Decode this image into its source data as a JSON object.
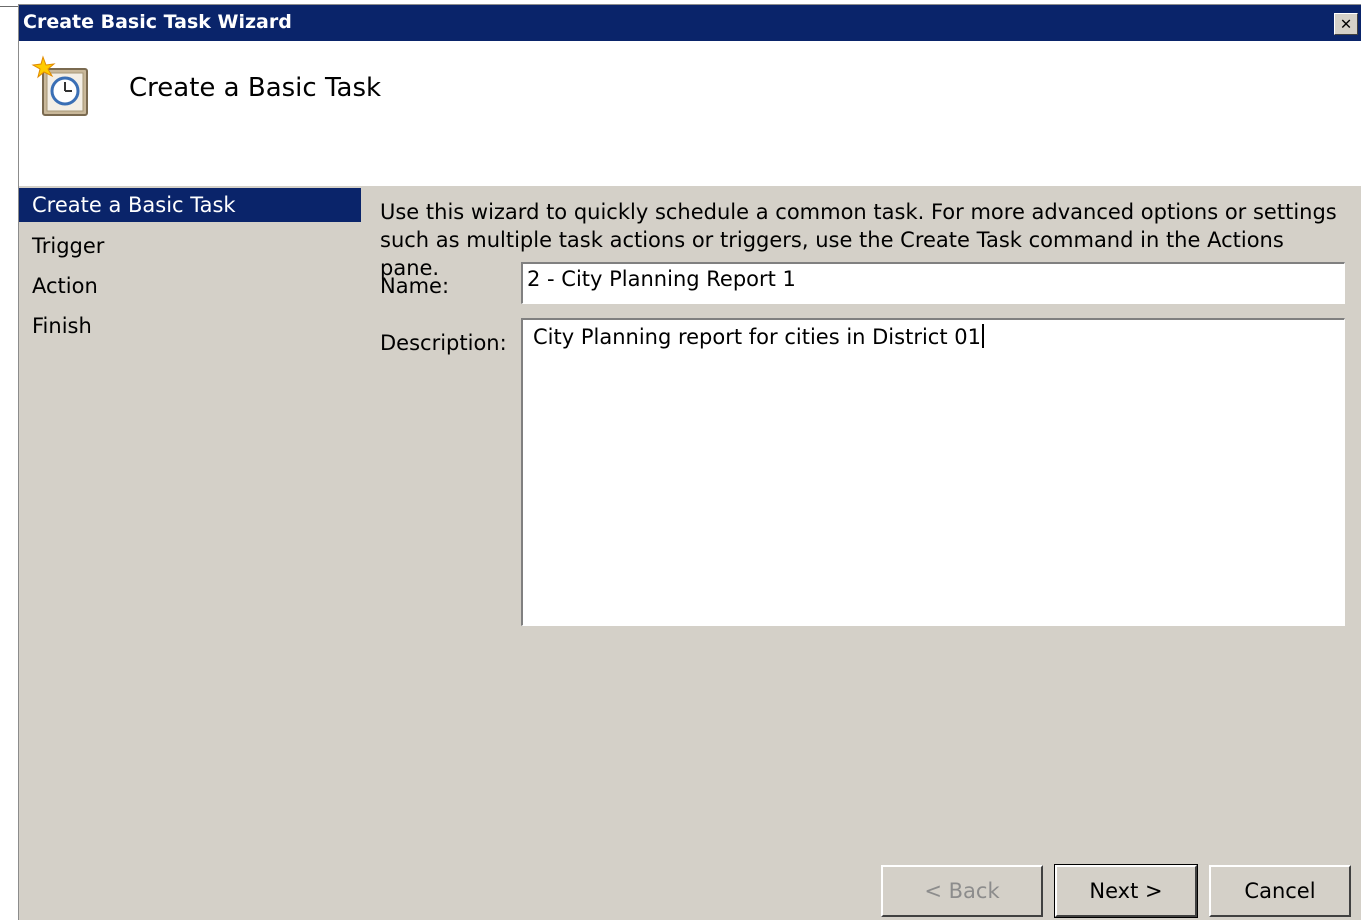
{
  "window": {
    "title": "Create Basic Task Wizard",
    "close_glyph": "✕"
  },
  "header": {
    "heading": "Create a Basic Task",
    "icon": "task-scheduler-clock-icon"
  },
  "steps": [
    {
      "label": "Create a Basic Task",
      "active": true
    },
    {
      "label": "Trigger"
    },
    {
      "label": "Action"
    },
    {
      "label": "Finish"
    }
  ],
  "content": {
    "intro_line1": "Use this wizard to quickly schedule a common task.  For more advanced options or settings",
    "intro_line2": "such as multiple task actions or triggers, use the Create Task command in the Actions pane.",
    "name_label": "Name:",
    "name_value": "2 - City Planning Report 1",
    "description_label": "Description:",
    "description_value": "City Planning report for cities in District 01"
  },
  "buttons": {
    "back": "< Back",
    "next": "Next >",
    "cancel": "Cancel"
  },
  "colors": {
    "titlebar": "#0a246a",
    "dialog_face": "#d4d0c8",
    "selection": "#0a246a"
  }
}
